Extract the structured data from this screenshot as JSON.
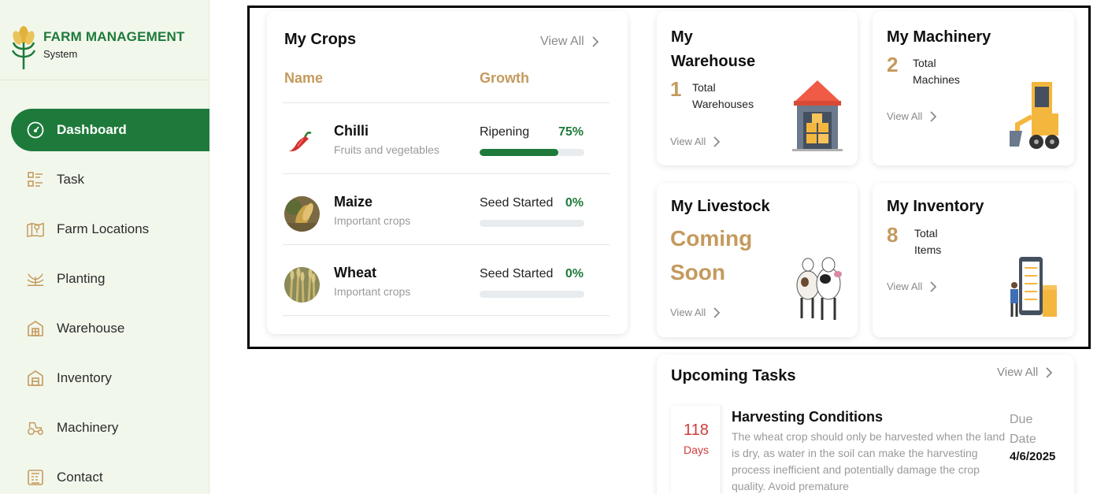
{
  "brand": {
    "title": "FARM MANAGEMENT",
    "subtitle": "System"
  },
  "sidebar": {
    "items": [
      {
        "label": "Dashboard",
        "icon": "gauge-icon",
        "active": true
      },
      {
        "label": "Task",
        "icon": "task-list-icon"
      },
      {
        "label": "Farm Locations",
        "icon": "map-pin-icon"
      },
      {
        "label": "Planting",
        "icon": "sprout-icon"
      },
      {
        "label": "Warehouse",
        "icon": "warehouse-icon"
      },
      {
        "label": "Inventory",
        "icon": "inventory-icon"
      },
      {
        "label": "Machinery",
        "icon": "tractor-icon"
      },
      {
        "label": "Contact",
        "icon": "contact-icon"
      }
    ]
  },
  "crops": {
    "title": "My Crops",
    "view_all": "View All",
    "col_name": "Name",
    "col_growth": "Growth",
    "rows": [
      {
        "name": "Chilli",
        "category": "Fruits and vegetables",
        "stage": "Ripening",
        "percent_label": "75%",
        "progress": 0.75,
        "icon": "chilli-icon"
      },
      {
        "name": "Maize",
        "category": "Important crops",
        "stage": "Seed Started",
        "percent_label": "0%",
        "progress": 0,
        "icon": "maize-photo"
      },
      {
        "name": "Wheat",
        "category": "Important crops",
        "stage": "Seed Started",
        "percent_label": "0%",
        "progress": 0,
        "icon": "wheat-photo"
      }
    ]
  },
  "warehouse": {
    "title_line1": "My",
    "title_line2": "Warehouse",
    "count": "1",
    "label_line1": "Total",
    "label_line2": "Warehouses",
    "view_all": "View All"
  },
  "machinery": {
    "title": "My Machinery",
    "count": "2",
    "label_line1": "Total",
    "label_line2": "Machines",
    "view_all": "View All"
  },
  "livestock": {
    "title": "My Livestock",
    "coming_line1": "Coming",
    "coming_line2": "Soon",
    "view_all": "View All"
  },
  "inventory": {
    "title": "My Inventory",
    "count": "8",
    "label_line1": "Total",
    "label_line2": "Items",
    "view_all": "View All"
  },
  "tasks": {
    "title": "Upcoming Tasks",
    "view_all": "View All",
    "item": {
      "days": "118",
      "days_label": "Days",
      "name": "Harvesting Conditions",
      "description": "The wheat crop should only be harvested when the land is dry, as water in the soil can make the harvesting process inefficient and potentially damage the crop quality. Avoid premature",
      "due_line1": "Due",
      "due_line2": "Date",
      "due_date": "4/6/2025"
    }
  },
  "colors": {
    "primary": "#1e7a3a",
    "accent": "#c49a5d",
    "danger": "#d13b3b",
    "sidebar_bg": "#f2f7ec"
  }
}
